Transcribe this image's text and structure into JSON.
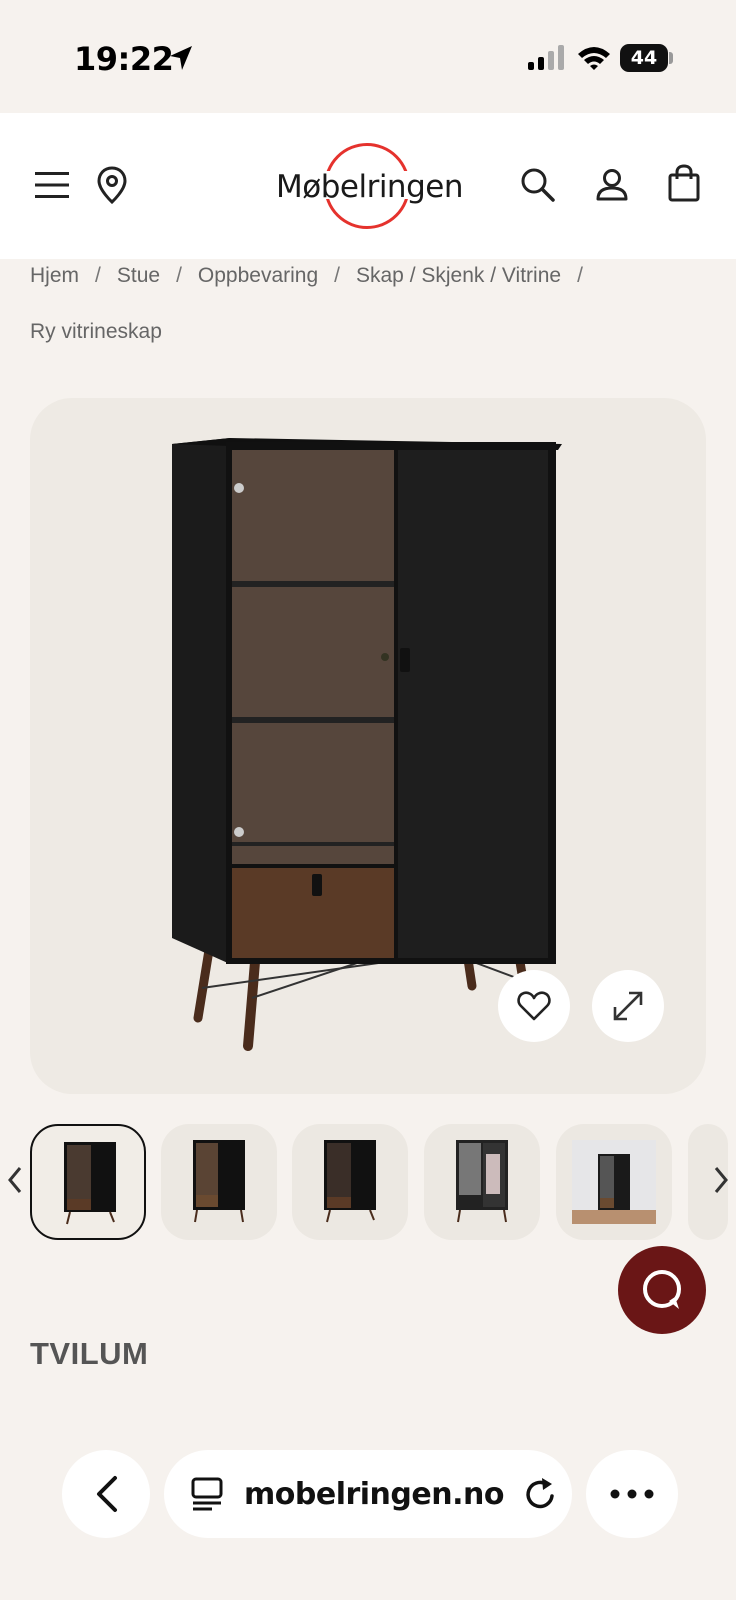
{
  "status_bar": {
    "time": "19:22",
    "battery": "44"
  },
  "header": {
    "logo_text": "Møbelringen"
  },
  "breadcrumbs": [
    {
      "label": "Hjem"
    },
    {
      "label": "Stue"
    },
    {
      "label": "Oppbevaring"
    },
    {
      "label": "Skap / Skjenk / Vitrine"
    }
  ],
  "breadcrumb_separator": "/",
  "breadcrumb_current": "Ry vitrineskap",
  "product": {
    "brand": "TVILUM"
  },
  "thumbnails": {
    "count_visible": 6,
    "active_index": 0
  },
  "browser": {
    "url": "mobelringen.no"
  },
  "colors": {
    "accent_red": "#e5322d",
    "chat_bg": "#6a1616",
    "page_bg": "#f6f2ee"
  }
}
